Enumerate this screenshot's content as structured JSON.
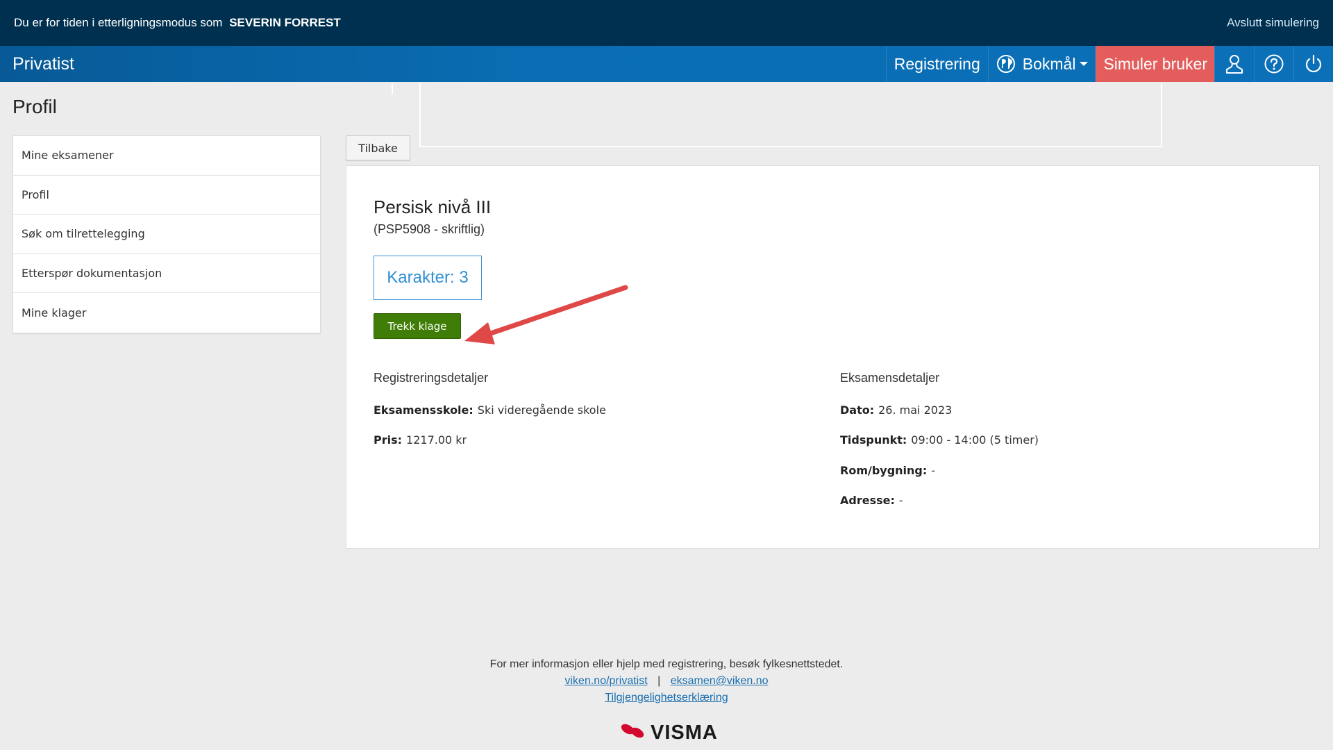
{
  "simulation": {
    "prefix": "Du er for tiden i etterligningsmodus som",
    "user": "SEVERIN FORREST",
    "exit_label": "Avslutt simulering"
  },
  "nav": {
    "brand": "Privatist",
    "register": "Registrering",
    "language": "Bokmål",
    "simulate": "Simuler bruker",
    "icons": [
      "globe-icon",
      "user-icon",
      "help-icon",
      "power-icon"
    ]
  },
  "page": {
    "title": "Profil"
  },
  "sidebar": {
    "items": [
      {
        "label": "Mine eksamener"
      },
      {
        "label": "Profil"
      },
      {
        "label": "Søk om tilrettelegging"
      },
      {
        "label": "Etterspør dokumentasjon"
      },
      {
        "label": "Mine klager"
      }
    ]
  },
  "back_label": "Tilbake",
  "exam": {
    "title": "Persisk nivå III",
    "code": "(PSP5908 - skriftlig)",
    "grade": "Karakter: 3",
    "withdraw_label": "Trekk klage",
    "registration_heading": "Registreringsdetaljer",
    "exam_heading": "Eksamensdetaljer",
    "registration": {
      "school_label": "Eksamensskole:",
      "school": "Ski videregående skole",
      "price_label": "Pris:",
      "price": "1217.00 kr"
    },
    "details": {
      "date_label": "Dato:",
      "date": "26. mai 2023",
      "time_label": "Tidspunkt:",
      "time": "09:00 - 14:00 (5 timer)",
      "room_label": "Rom/bygning:",
      "room": "-",
      "address_label": "Adresse:",
      "address": "-"
    }
  },
  "footer": {
    "info": "For mer informasjon eller hjelp med registrering, besøk fylkesnettstedet.",
    "link1": "viken.no/privatist",
    "separator": "|",
    "link2": "eksamen@viken.no",
    "link3": "Tilgjengelighetserklæring",
    "logo": "VISMA"
  },
  "colors": {
    "sim_bar": "#00304f",
    "nav": "#0b70b8",
    "simulate": "#e35d5d",
    "grade": "#2f8fd4",
    "withdraw": "#3f7d06",
    "arrow": "#e04848"
  }
}
